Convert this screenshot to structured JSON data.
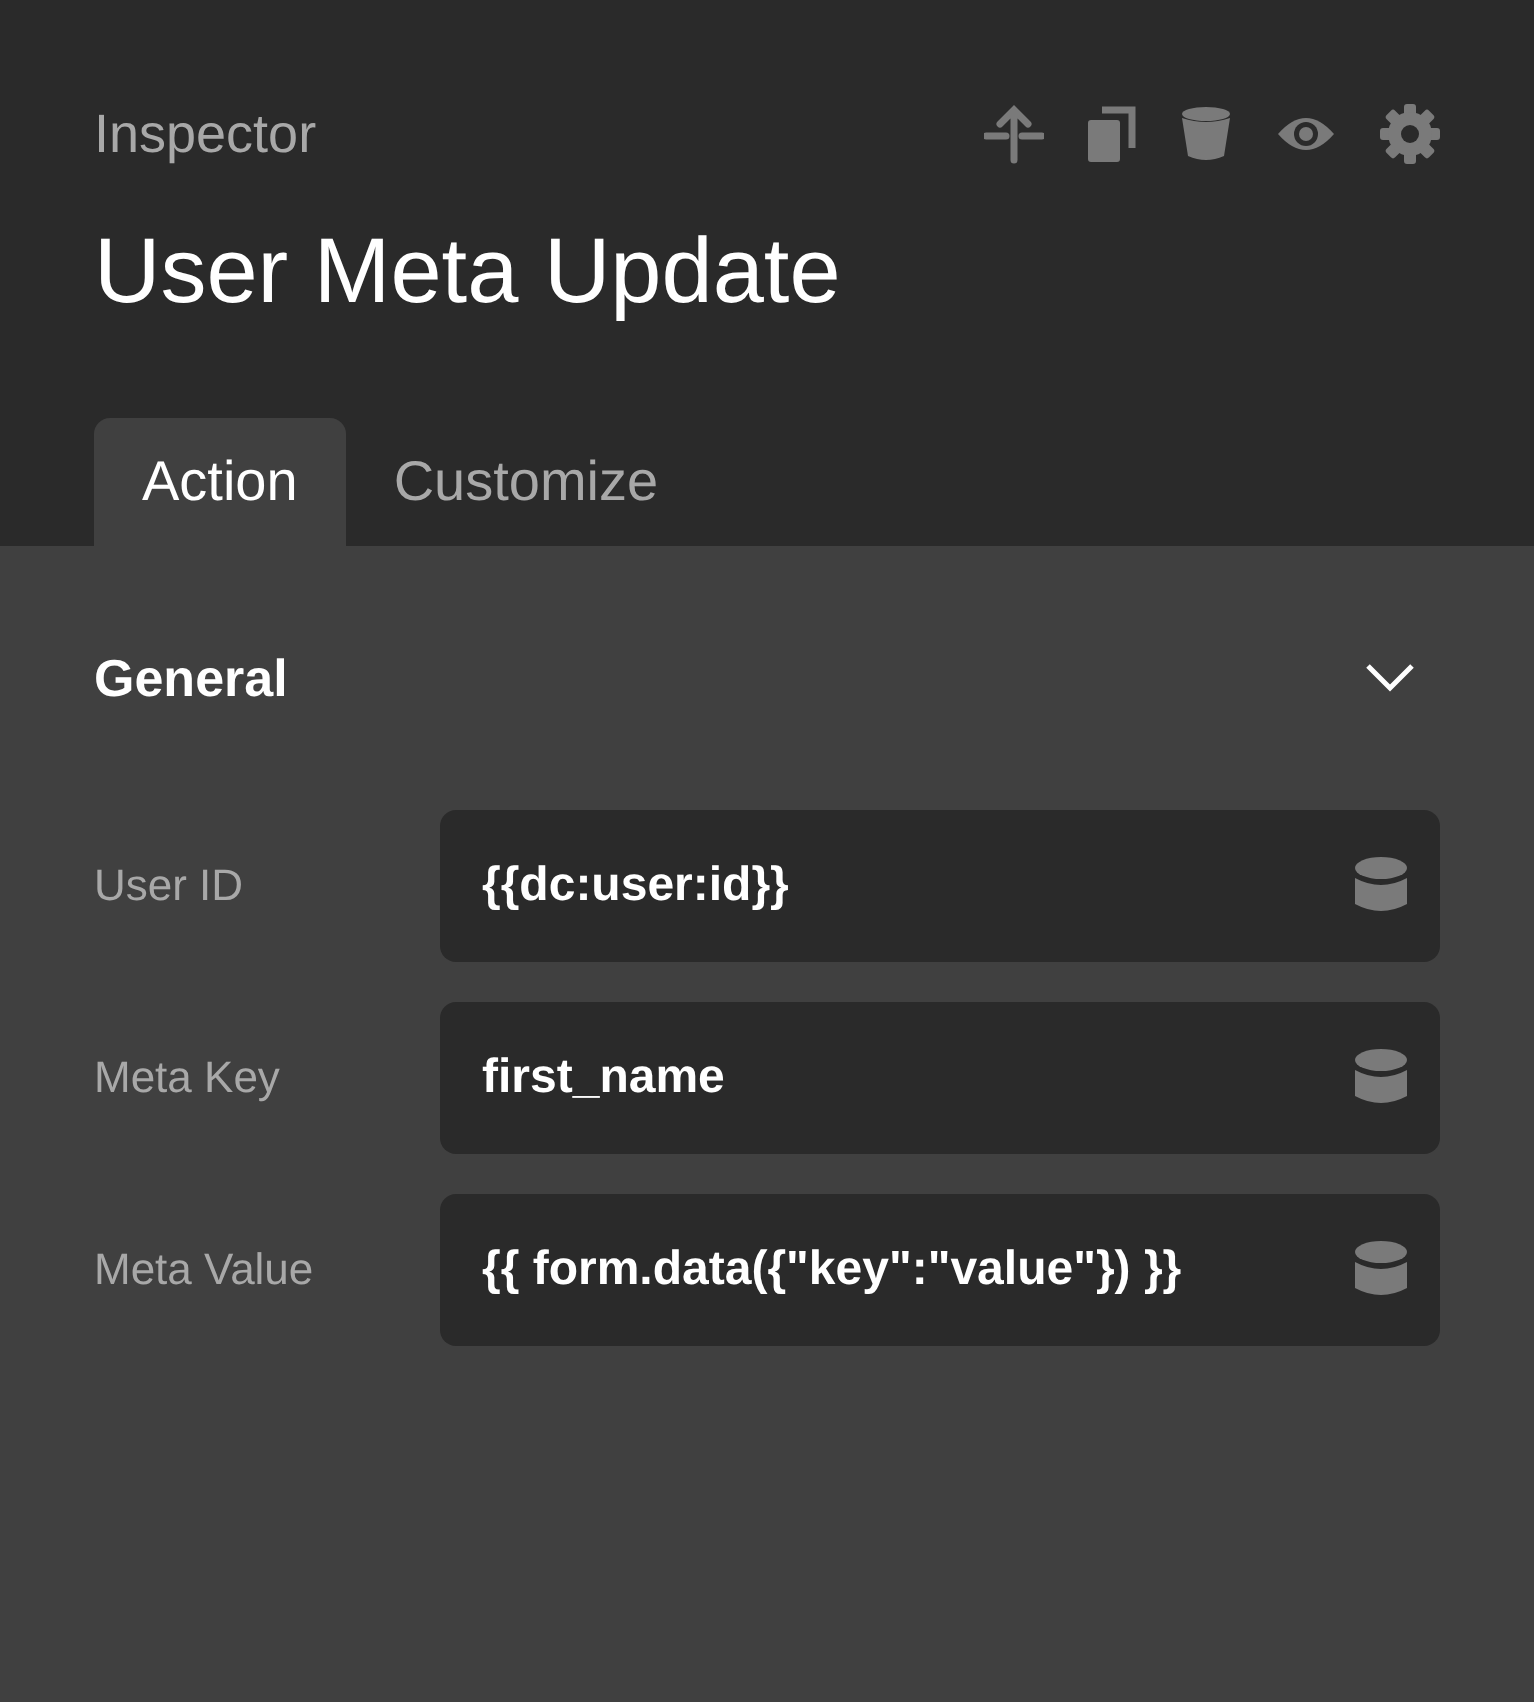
{
  "header": {
    "label": "Inspector",
    "title": "User Meta Update"
  },
  "tabs": [
    {
      "label": "Action",
      "selected": true
    },
    {
      "label": "Customize",
      "selected": false
    }
  ],
  "section": {
    "title": "General",
    "expanded": true,
    "fields": [
      {
        "label": "User ID",
        "value": "{{dc:user:id}}"
      },
      {
        "label": "Meta Key",
        "value": "first_name"
      },
      {
        "label": "Meta Value",
        "value": "{{ form.data({\"key\":\"value\"}) }}"
      }
    ]
  }
}
